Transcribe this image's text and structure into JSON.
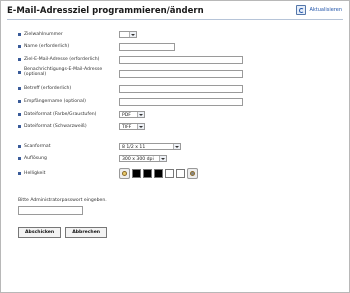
{
  "page": {
    "title": "E-Mail-Adressziel programmieren/ändern",
    "refresh_label": "Aktualisieren"
  },
  "form": {
    "fields": [
      {
        "label": "Zielwahlnummer",
        "type": "select",
        "value": ""
      },
      {
        "label": "Name (erforderlich)",
        "type": "input",
        "value": ""
      },
      {
        "label": "Ziel-E-Mail-Adresse (erforderlich)",
        "type": "input",
        "value": ""
      },
      {
        "label": "Benachrichtigungs-E-Mail-Adresse (optional)",
        "type": "input",
        "value": ""
      },
      {
        "label": "Betreff (erforderlich)",
        "type": "input",
        "value": ""
      },
      {
        "label": "Empfängername (optional)",
        "type": "input",
        "value": ""
      },
      {
        "label": "Dateiformat (Farbe/Graustufen)",
        "type": "select",
        "value": "PDF"
      },
      {
        "label": "Dateiformat (Schwarzweiß)",
        "type": "select",
        "value": "TIFF"
      },
      {
        "label": "Scanformat",
        "type": "select",
        "value": "8 1/2 x 11"
      },
      {
        "label": "Auflösung",
        "type": "select",
        "value": "300 x 300 dpi"
      },
      {
        "label": "Helligkeit",
        "type": "brightness",
        "value": ""
      }
    ],
    "admin_password_label": "Bitte Administratorpasswort eingeben."
  },
  "buttons": {
    "submit": "Abschicken",
    "cancel": "Abbrechen"
  },
  "colors": {
    "bullet": "#3a5b99",
    "link": "#2255aa"
  }
}
